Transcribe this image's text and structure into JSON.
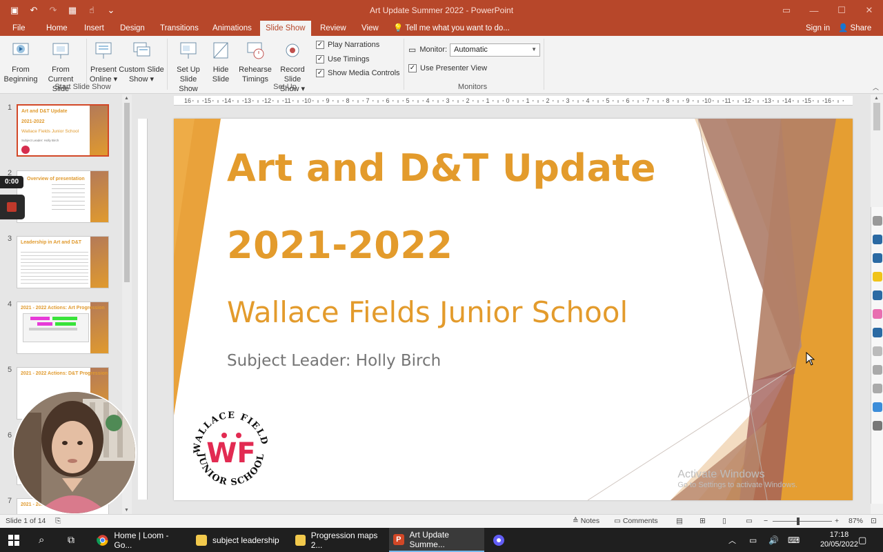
{
  "window": {
    "title": "Art Update Summer 2022 - PowerPoint",
    "min": "—",
    "max": "☐",
    "close": "✕"
  },
  "tabs": [
    "File",
    "Home",
    "Insert",
    "Design",
    "Transitions",
    "Animations",
    "Slide Show",
    "Review",
    "View"
  ],
  "tell_me": "Tell me what you want to do...",
  "sign_in": "Sign in",
  "share": "Share",
  "ribbon": {
    "from_beginning": [
      "From",
      "Beginning"
    ],
    "from_current": [
      "From",
      "Current Slide"
    ],
    "present_online": [
      "Present",
      "Online ▾"
    ],
    "custom_show": [
      "Custom Slide",
      "Show ▾"
    ],
    "group_start": "Start Slide Show",
    "set_up": [
      "Set Up",
      "Slide Show"
    ],
    "hide_slide": [
      "Hide",
      "Slide"
    ],
    "rehearse": [
      "Rehearse",
      "Timings"
    ],
    "record": [
      "Record Slide",
      "Show ▾"
    ],
    "play_narrations": "Play Narrations",
    "use_timings": "Use Timings",
    "show_media": "Show Media Controls",
    "group_setup": "Set Up",
    "monitor_label": "Monitor:",
    "monitor_value": "Automatic",
    "presenter_view": "Use Presenter View",
    "group_monitors": "Monitors"
  },
  "thumbnails": [
    {
      "num": "1",
      "title": "Art and D&T Update"
    },
    {
      "num": "2",
      "title": "Overview of presentation"
    },
    {
      "num": "3",
      "title": "Leadership in Art and D&T"
    },
    {
      "num": "4",
      "title": "2021 - 2022 Actions: Art Progression"
    },
    {
      "num": "5",
      "title": "2021 - 2022 Actions: D&T Progression"
    },
    {
      "num": "6",
      "title": ""
    },
    {
      "num": "7",
      "title": "2021 - 2022"
    }
  ],
  "loom": {
    "time": "0:00"
  },
  "slide": {
    "title_line1": "Art and D&T Update",
    "title_line2": "2021-2022",
    "school": "Wallace Fields Junior School",
    "leader": "Subject Leader: Holly Birch",
    "logo_top": "WALLACE FIELDS",
    "logo_bottom": "JUNIOR SCHOOL",
    "logo_mark": "WF",
    "activate_1": "Activate Windows",
    "activate_2": "Go to Settings to activate Windows."
  },
  "ruler_ticks": [
    "16",
    "15",
    "14",
    "13",
    "12",
    "11",
    "10",
    "9",
    "8",
    "7",
    "6",
    "5",
    "4",
    "3",
    "2",
    "1",
    "0",
    "1",
    "2",
    "3",
    "4",
    "5",
    "6",
    "7",
    "8",
    "9",
    "10",
    "11",
    "12",
    "13",
    "14",
    "15",
    "16"
  ],
  "status": {
    "slide_of": "Slide 1 of 14",
    "notes": "Notes",
    "comments": "Comments",
    "zoom": "87%"
  },
  "taskbar": {
    "chrome": "Home | Loom - Go...",
    "folder1": "subject leadership",
    "folder2": "Progression maps 2...",
    "ppt": "Art Update Summe...",
    "time": "17:18",
    "date": "20/05/2022"
  },
  "colors": {
    "accent": "#b7472a",
    "title_orange": "#e39b2c",
    "brown": "#9b6a58"
  }
}
